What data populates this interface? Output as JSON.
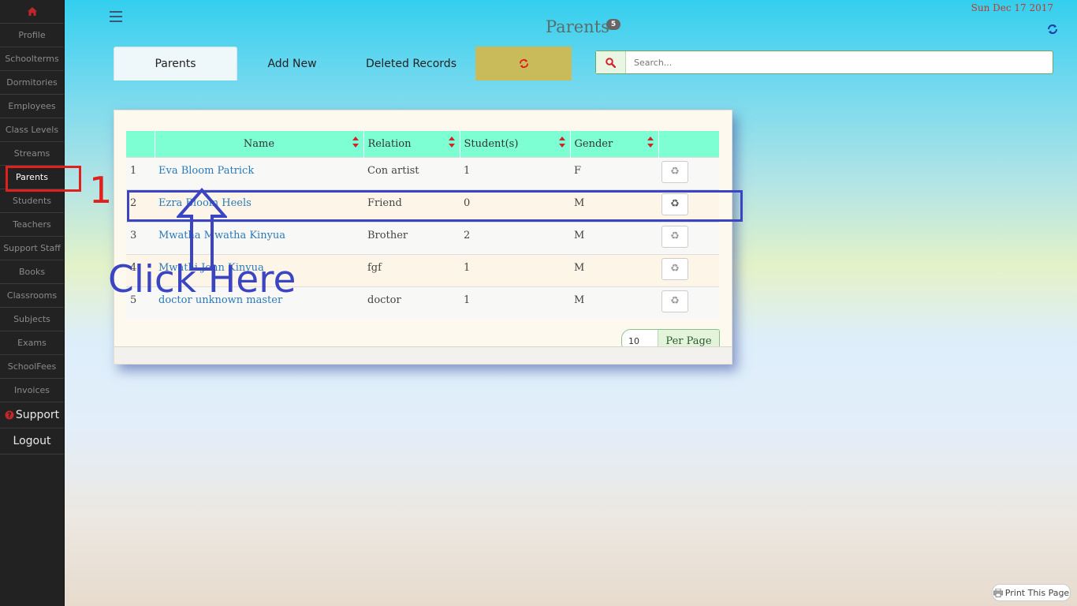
{
  "sidebar": {
    "home_icon": "home-icon",
    "items": [
      {
        "label": "Profile"
      },
      {
        "label": "Schoolterms"
      },
      {
        "label": "Dormitories"
      },
      {
        "label": "Employees"
      },
      {
        "label": "Class Levels"
      },
      {
        "label": "Streams"
      },
      {
        "label": "Parents"
      },
      {
        "label": "Students"
      },
      {
        "label": "Teachers"
      },
      {
        "label": "Support Staff"
      },
      {
        "label": "Books"
      },
      {
        "label": "Classrooms"
      },
      {
        "label": "Subjects"
      },
      {
        "label": "Exams"
      },
      {
        "label": "SchoolFees"
      },
      {
        "label": "Invoices"
      }
    ],
    "active_item": "Parents",
    "support_label": "Support",
    "logout_label": "Logout"
  },
  "header": {
    "title": "Parents",
    "count": "5",
    "date": "Sun Dec 17 2017"
  },
  "tabs": [
    {
      "label": "Parents",
      "active": true
    },
    {
      "label": "Add New"
    },
    {
      "label": "Deleted Records"
    }
  ],
  "search": {
    "placeholder": "Search..."
  },
  "table": {
    "columns": [
      "Name",
      "Relation",
      "Student(s)",
      "Gender"
    ],
    "rows": [
      {
        "num": "1",
        "name": "Eva Bloom Patrick",
        "relation": "Con artist",
        "students": "1",
        "gender": "F"
      },
      {
        "num": "2",
        "name": "Ezra Bloom Heels",
        "relation": "Friend",
        "students": "0",
        "gender": "M"
      },
      {
        "num": "3",
        "name": "Mwatha Mwatha Kinyua",
        "relation": "Brother",
        "students": "2",
        "gender": "M"
      },
      {
        "num": "4",
        "name": "Mwathi John Kinyua",
        "relation": "fgf",
        "students": "1",
        "gender": "M"
      },
      {
        "num": "5",
        "name": "doctor unknown master",
        "relation": "doctor",
        "students": "1",
        "gender": "M"
      }
    ]
  },
  "pagination": {
    "per_page_value": "10",
    "per_page_label": "Per Page"
  },
  "print_label": "Print This Page",
  "annotations": {
    "step_number": "1",
    "click_text": "Click Here"
  },
  "colors": {
    "sidebar_bg": "#222222",
    "accent_red": "#e0201c",
    "annotation_blue": "#3b45c4",
    "table_header": "#7dffd3",
    "refresh_tab": "#c9ba5a"
  }
}
